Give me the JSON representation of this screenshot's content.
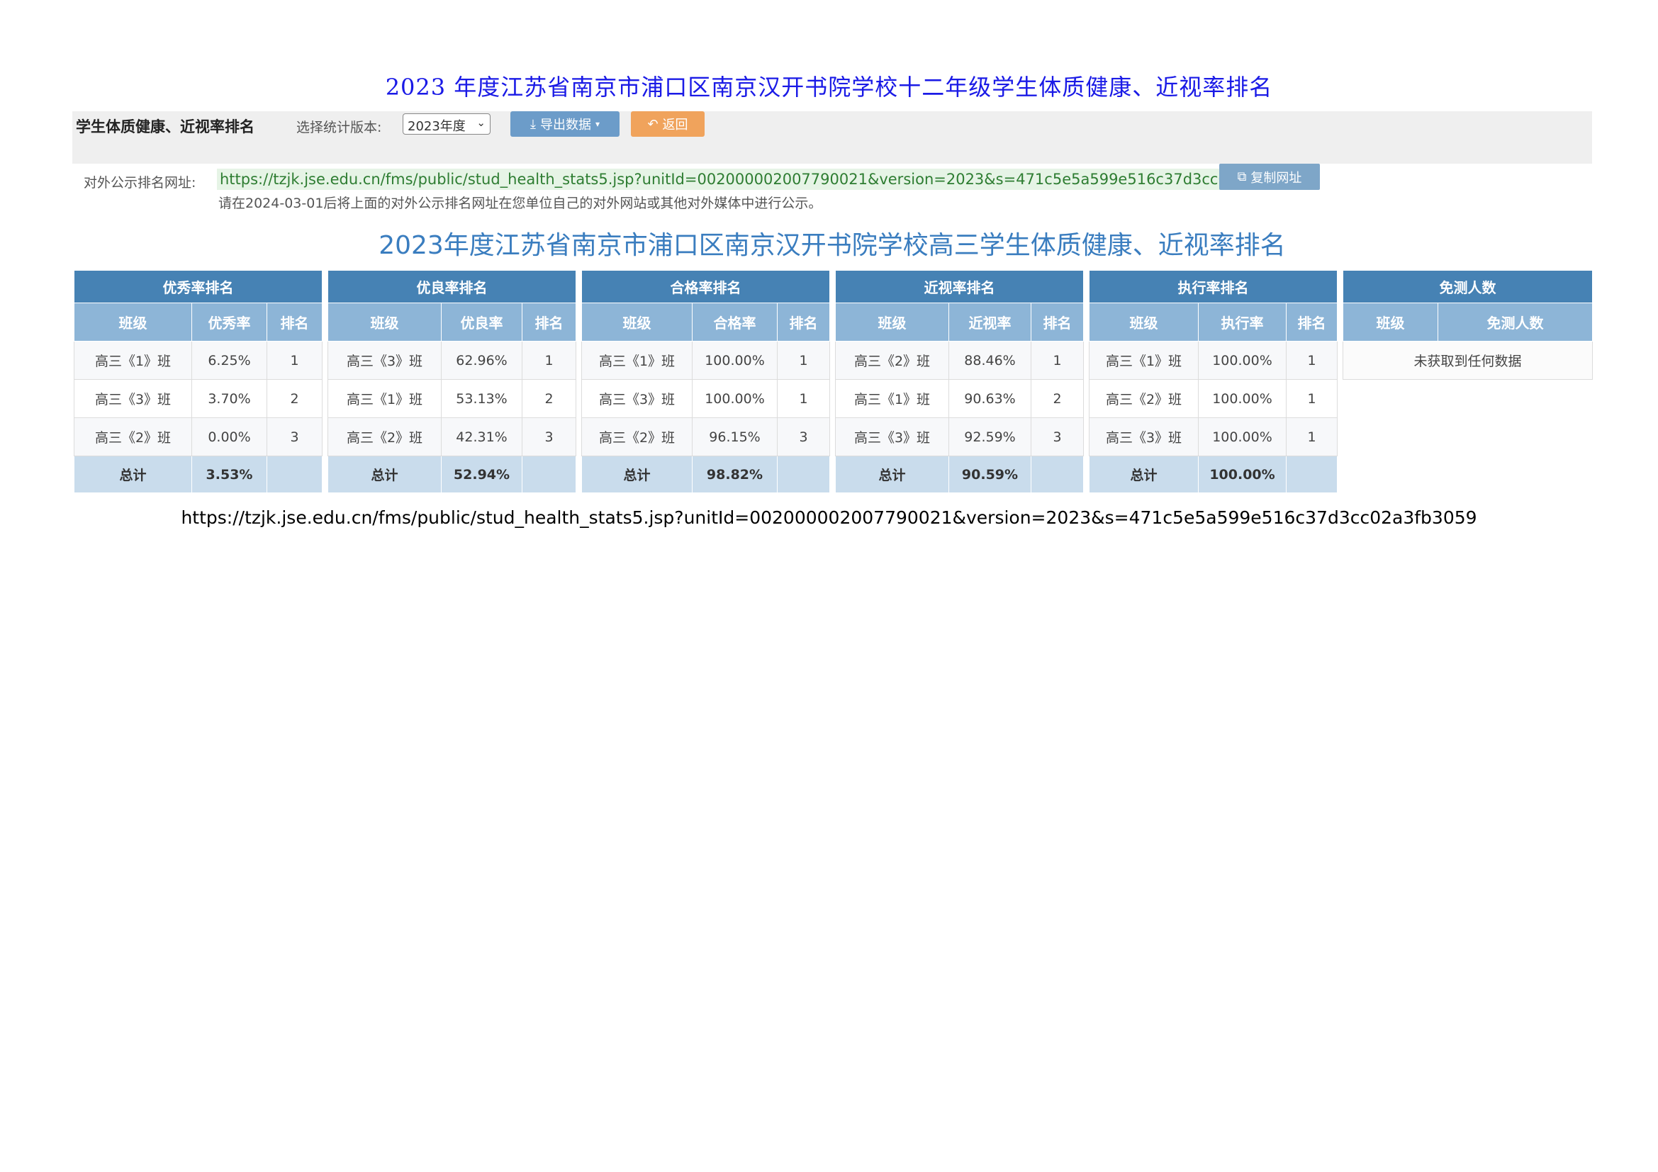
{
  "document": {
    "title": "2023 年度江苏省南京市浦口区南京汉开书院学校十二年级学生体质健康、近视率排名",
    "footer_url": "https://tzjk.jse.edu.cn/fms/public/stud_health_stats5.jsp?unitId=002000002007790021&version=2023&s=471c5e5a599e516c37d3cc02a3fb3059"
  },
  "toolbar": {
    "title": "学生体质健康、近视率排名",
    "version_label": "选择统计版本:",
    "version_selected": "2023年度",
    "export_label": "导出数据",
    "back_label": "返回"
  },
  "public_url": {
    "label": "对外公示排名网址:",
    "url": "https://tzjk.jse.edu.cn/fms/public/stud_health_stats5.jsp?unitId=002000002007790021&version=2023&s=471c5e5a599e516c37d3cc02a3fb3059",
    "copy_label": "复制网址",
    "note": "请在2024-03-01后将上面的对外公示排名网址在您单位自己的对外网站或其他对外媒体中进行公示。"
  },
  "page_title": "2023年度江苏省南京市浦口区南京汉开书院学校高三学生体质健康、近视率排名",
  "tables": [
    {
      "title": "优秀率排名",
      "headers": [
        "班级",
        "优秀率",
        "排名"
      ],
      "rows": [
        [
          "高三《1》班",
          "6.25%",
          "1"
        ],
        [
          "高三《3》班",
          "3.70%",
          "2"
        ],
        [
          "高三《2》班",
          "0.00%",
          "3"
        ]
      ],
      "total": [
        "总计",
        "3.53%",
        ""
      ]
    },
    {
      "title": "优良率排名",
      "headers": [
        "班级",
        "优良率",
        "排名"
      ],
      "rows": [
        [
          "高三《3》班",
          "62.96%",
          "1"
        ],
        [
          "高三《1》班",
          "53.13%",
          "2"
        ],
        [
          "高三《2》班",
          "42.31%",
          "3"
        ]
      ],
      "total": [
        "总计",
        "52.94%",
        ""
      ]
    },
    {
      "title": "合格率排名",
      "headers": [
        "班级",
        "合格率",
        "排名"
      ],
      "rows": [
        [
          "高三《1》班",
          "100.00%",
          "1"
        ],
        [
          "高三《3》班",
          "100.00%",
          "1"
        ],
        [
          "高三《2》班",
          "96.15%",
          "3"
        ]
      ],
      "total": [
        "总计",
        "98.82%",
        ""
      ]
    },
    {
      "title": "近视率排名",
      "headers": [
        "班级",
        "近视率",
        "排名"
      ],
      "rows": [
        [
          "高三《2》班",
          "88.46%",
          "1"
        ],
        [
          "高三《1》班",
          "90.63%",
          "2"
        ],
        [
          "高三《3》班",
          "92.59%",
          "3"
        ]
      ],
      "total": [
        "总计",
        "90.59%",
        ""
      ]
    },
    {
      "title": "执行率排名",
      "headers": [
        "班级",
        "执行率",
        "排名"
      ],
      "rows": [
        [
          "高三《1》班",
          "100.00%",
          "1"
        ],
        [
          "高三《2》班",
          "100.00%",
          "1"
        ],
        [
          "高三《3》班",
          "100.00%",
          "1"
        ]
      ],
      "total": [
        "总计",
        "100.00%",
        ""
      ]
    }
  ],
  "exempt_table": {
    "title": "免测人数",
    "headers": [
      "班级",
      "免测人数"
    ],
    "empty_text": "未获取到任何数据"
  }
}
